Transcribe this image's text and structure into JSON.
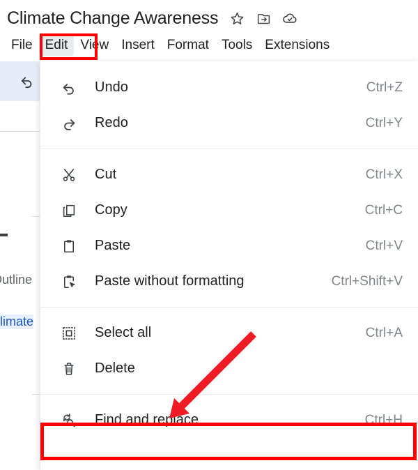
{
  "document": {
    "title": "Climate Change Awareness",
    "header_icons": [
      {
        "name": "star-icon",
        "label": "Star"
      },
      {
        "name": "move-to-folder-icon",
        "label": "Move"
      },
      {
        "name": "cloud-saved-icon",
        "label": "Saved to Drive"
      }
    ]
  },
  "menubar": {
    "items": [
      {
        "label": "File",
        "active": false
      },
      {
        "label": "Edit",
        "active": true
      },
      {
        "label": "View",
        "active": false
      },
      {
        "label": "Insert",
        "active": false
      },
      {
        "label": "Format",
        "active": false
      },
      {
        "label": "Tools",
        "active": false
      },
      {
        "label": "Extensions",
        "active": false
      }
    ]
  },
  "sidebar": {
    "toolbar_icon": "undo-icon",
    "outline_label": "Outline",
    "outline_entry": "Climate"
  },
  "edit_menu": {
    "groups": [
      {
        "items": [
          {
            "icon": "undo-icon",
            "label": "Undo",
            "accel": "Ctrl+Z"
          },
          {
            "icon": "redo-icon",
            "label": "Redo",
            "accel": "Ctrl+Y"
          }
        ]
      },
      {
        "items": [
          {
            "icon": "cut-icon",
            "label": "Cut",
            "accel": "Ctrl+X"
          },
          {
            "icon": "copy-icon",
            "label": "Copy",
            "accel": "Ctrl+C"
          },
          {
            "icon": "paste-icon",
            "label": "Paste",
            "accel": "Ctrl+V"
          },
          {
            "icon": "paste-plain-icon",
            "label": "Paste without formatting",
            "accel": "Ctrl+Shift+V"
          }
        ]
      },
      {
        "items": [
          {
            "icon": "select-all-icon",
            "label": "Select all",
            "accel": "Ctrl+A"
          },
          {
            "icon": "delete-icon",
            "label": "Delete",
            "accel": ""
          }
        ]
      },
      {
        "items": [
          {
            "icon": "find-replace-icon",
            "label": "Find and replace",
            "accel": "Ctrl+H"
          }
        ]
      }
    ]
  },
  "annotations": {
    "highlight_color": "#ff0000",
    "arrow_color": "#ee1c25",
    "highlighted_menu": "Edit",
    "highlighted_item": "Find and replace"
  }
}
